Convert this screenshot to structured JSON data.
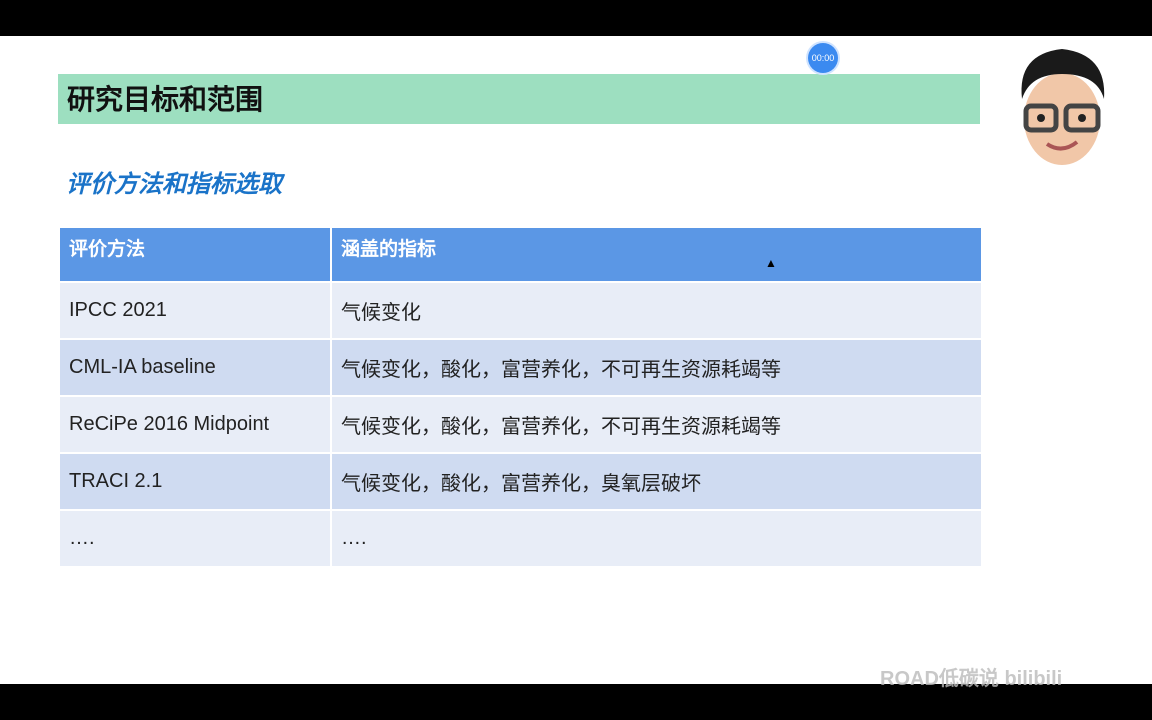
{
  "slide": {
    "title": "研究目标和范围",
    "subtitle": "评价方法和指标选取"
  },
  "timer": "00:00",
  "table": {
    "headers": [
      "评价方法",
      "涵盖的指标"
    ],
    "rows": [
      [
        "IPCC 2021",
        "气候变化"
      ],
      [
        "CML-IA baseline",
        "气候变化，酸化，富营养化，不可再生资源耗竭等"
      ],
      [
        "ReCiPe 2016 Midpoint",
        "气候变化，酸化，富营养化，不可再生资源耗竭等"
      ],
      [
        "TRACI 2.1",
        "气候变化，酸化，富营养化，臭氧层破坏"
      ],
      [
        "….",
        "…."
      ]
    ]
  },
  "watermark": "ROAD低碳说 bilibili"
}
